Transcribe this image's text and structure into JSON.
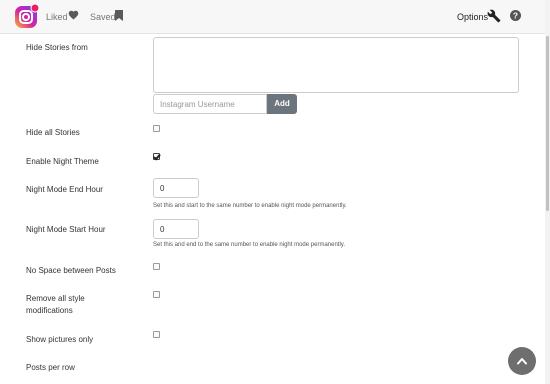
{
  "header": {
    "liked_label": "Liked",
    "saved_label": "Saved",
    "options_label": "Options",
    "icons": {
      "logo": "instagram-camera-logo",
      "liked": "heart-icon",
      "saved": "bookmark-icon",
      "options": "wrench-icon",
      "help": "question-circle-icon"
    },
    "logo_colors": [
      "#fd5949",
      "#d6249f",
      "#285aeb"
    ]
  },
  "form": {
    "hide_stories_from": {
      "label": "Hide Stories from",
      "textarea_value": "",
      "username_placeholder": "Instagram Username",
      "add_label": "Add"
    },
    "hide_all_stories": {
      "label": "Hide all Stories",
      "checked": false
    },
    "enable_night_theme": {
      "label": "Enable Night Theme",
      "checked": true
    },
    "night_mode_end_hour": {
      "label": "Night Mode End Hour",
      "value": "0",
      "hint": "Set this and start to the same number to enable night mode permanently."
    },
    "night_mode_start_hour": {
      "label": "Night Mode Start Hour",
      "value": "0",
      "hint": "Set this and end to the same number to enable night mode permanently."
    },
    "no_space_between_posts": {
      "label": "No Space between Posts",
      "checked": false
    },
    "remove_all_style_modifications": {
      "label_line1": "Remove all style",
      "label_line2": "modifications",
      "checked": false
    },
    "show_pictures_only": {
      "label": "Show pictures only",
      "checked": false
    },
    "posts_per_row": {
      "label": "Posts per row"
    }
  },
  "scroll_top_button": {
    "icon": "chevron-up-icon",
    "color": "#6e6e6e"
  },
  "colors": {
    "button_gray": "#6c757d",
    "topbar_bg": "#f7f7f7"
  }
}
